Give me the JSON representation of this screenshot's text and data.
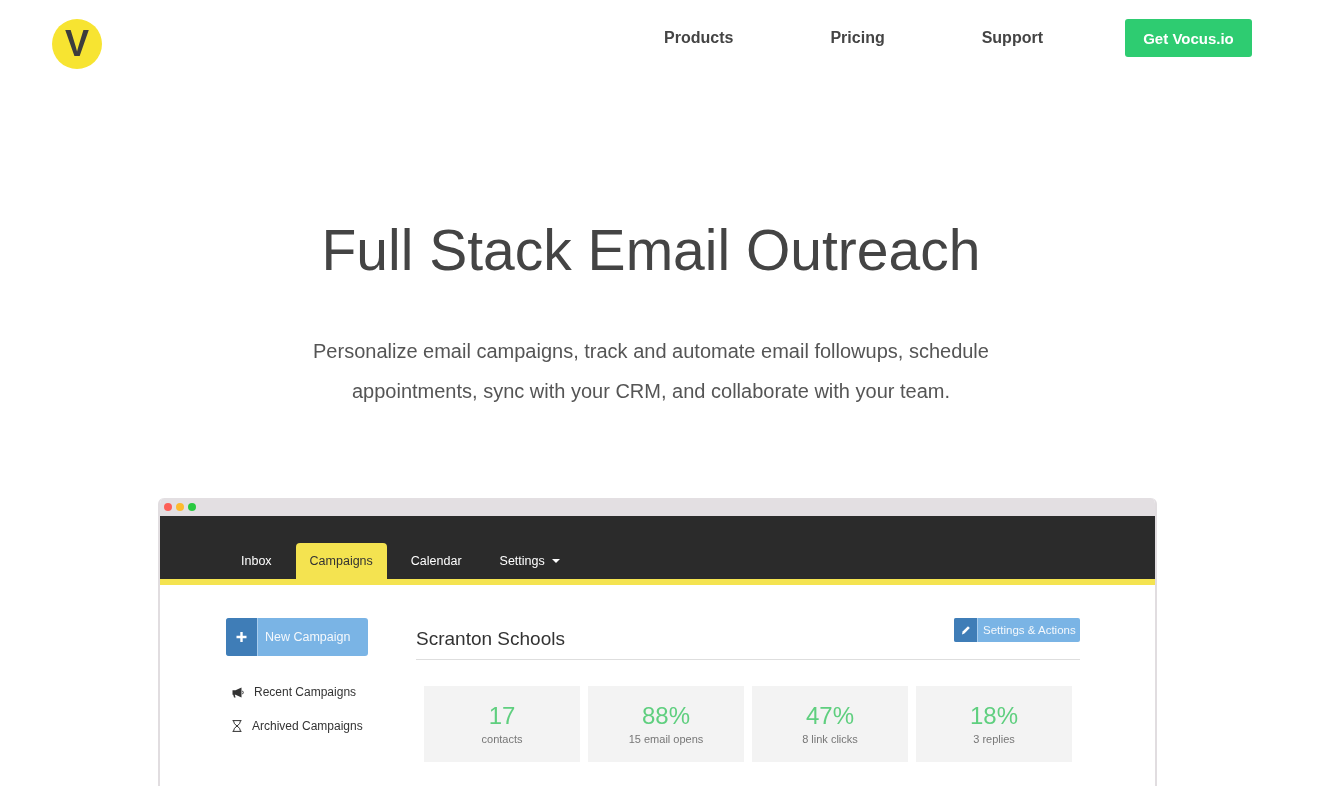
{
  "header": {
    "logo": {
      "letter": "V"
    },
    "nav": [
      {
        "label": "Products"
      },
      {
        "label": "Pricing"
      },
      {
        "label": "Support"
      }
    ],
    "cta": {
      "label": "Get Vocus.io"
    }
  },
  "hero": {
    "title": "Full Stack Email Outreach",
    "subtitle": "Personalize email campaigns, track and automate email followups, schedule appointments, sync with your CRM, and collaborate with your team."
  },
  "app_preview": {
    "tabs": [
      {
        "label": "Inbox",
        "selected": false,
        "dropdown": false
      },
      {
        "label": "Campaigns",
        "selected": true,
        "dropdown": false
      },
      {
        "label": "Calendar",
        "selected": false,
        "dropdown": false
      },
      {
        "label": "Settings",
        "selected": false,
        "dropdown": true
      }
    ],
    "sidebar": {
      "new_button": {
        "label": "New Campaign"
      },
      "items": [
        {
          "label": "Recent Campaigns",
          "kind": "recent"
        },
        {
          "label": "Archived Campaigns",
          "kind": "archived"
        }
      ]
    },
    "campaign": {
      "title": "Scranton Schools",
      "action_button": {
        "label": "Settings & Actions"
      },
      "stats": [
        {
          "value": "17",
          "label": "contacts"
        },
        {
          "value": "88%",
          "label": "15 email opens"
        },
        {
          "value": "47%",
          "label": "8 link clicks"
        },
        {
          "value": "18%",
          "label": "3 replies"
        }
      ]
    }
  }
}
